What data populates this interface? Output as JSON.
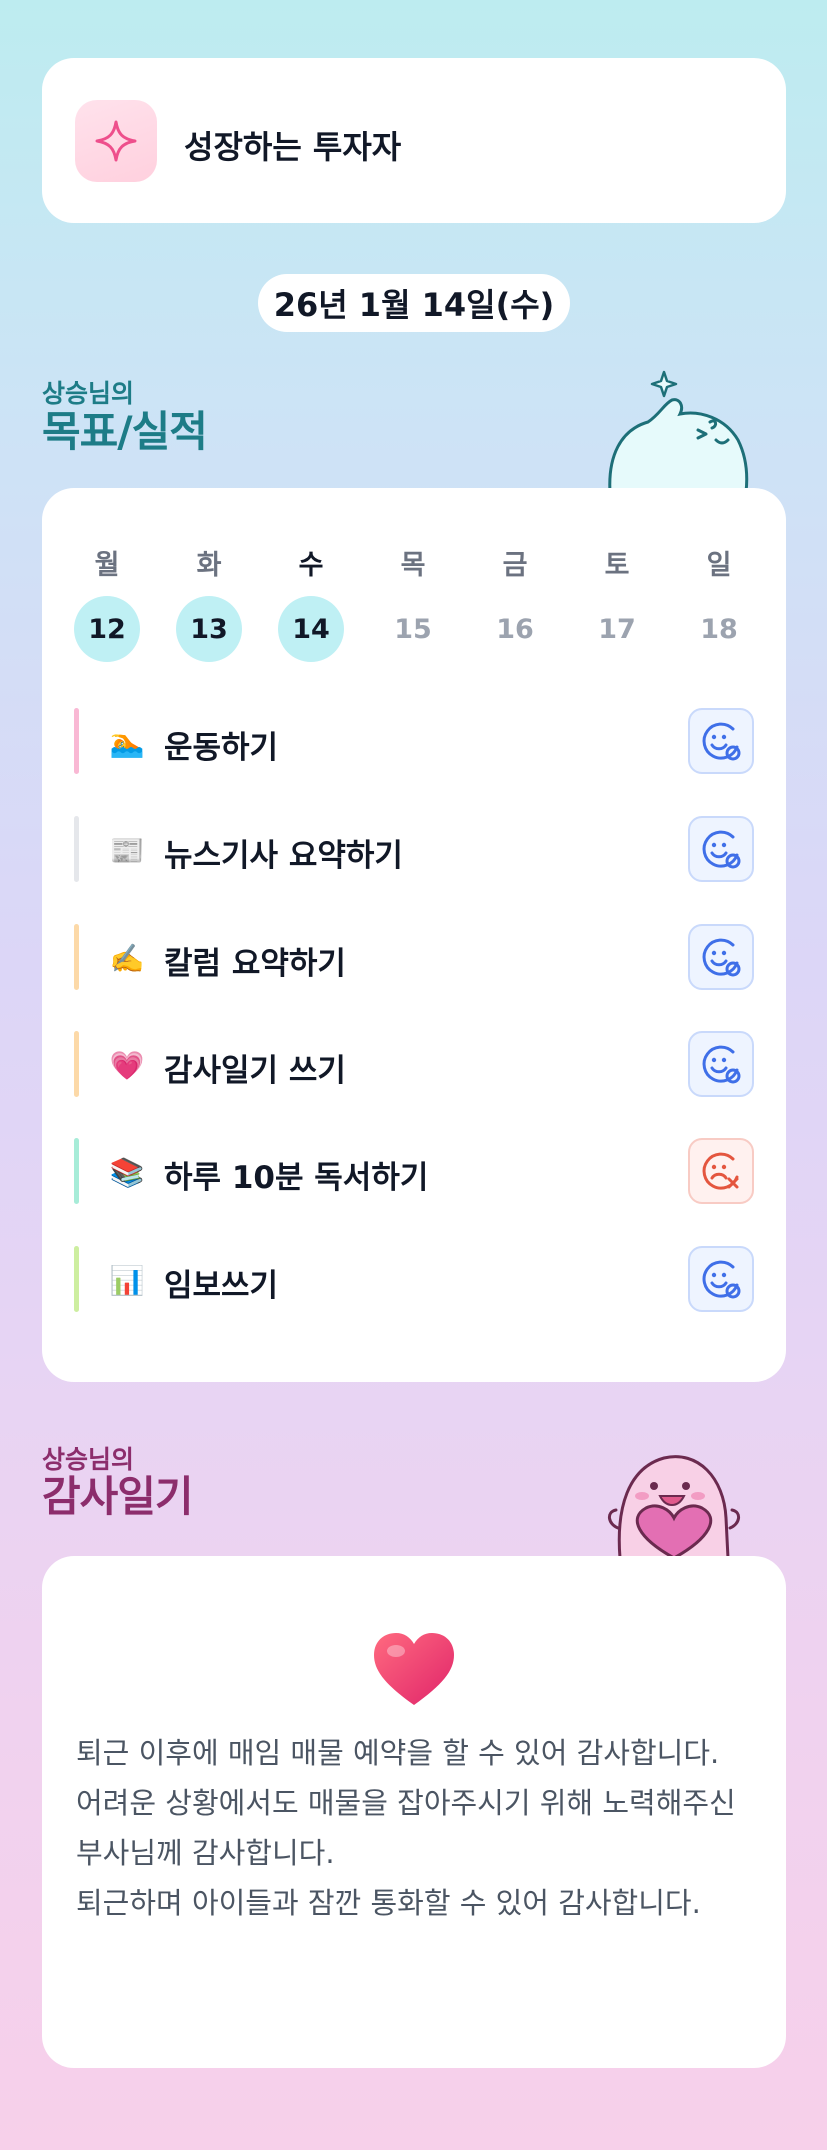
{
  "profile": {
    "name": "성장하는 투자자",
    "icon": "sparkle-icon"
  },
  "date": "26년 1월 14일(수)",
  "goals_section": {
    "owner": "상승님의",
    "title": "목표/실적"
  },
  "week": [
    {
      "day": "월",
      "num": "12",
      "done": true,
      "today": false
    },
    {
      "day": "화",
      "num": "13",
      "done": true,
      "today": false
    },
    {
      "day": "수",
      "num": "14",
      "done": true,
      "today": true
    },
    {
      "day": "목",
      "num": "15",
      "done": false,
      "today": false
    },
    {
      "day": "금",
      "num": "16",
      "done": false,
      "today": false
    },
    {
      "day": "토",
      "num": "17",
      "done": false,
      "today": false
    },
    {
      "day": "일",
      "num": "18",
      "done": false,
      "today": false
    }
  ],
  "goals": [
    {
      "emoji": "🏊",
      "label": "운동하기",
      "bar_color": "#f9b8d4",
      "status": "completed",
      "status_icon": "smile-check-icon"
    },
    {
      "emoji": "📰",
      "label": "뉴스기사 요약하기",
      "bar_color": "#e5e7eb",
      "status": "completed",
      "status_icon": "smile-check-icon"
    },
    {
      "emoji": "✍️",
      "label": "칼럼 요약하기",
      "bar_color": "#fcd9a8",
      "status": "completed",
      "status_icon": "smile-check-icon"
    },
    {
      "emoji": "💗",
      "label": "감사일기 쓰기",
      "bar_color": "#fcd9a8",
      "status": "completed",
      "status_icon": "smile-check-icon"
    },
    {
      "emoji": "📚",
      "label": "하루 10분 독서하기",
      "bar_color": "#a7ecd8",
      "status": "failed",
      "status_icon": "sad-x-icon"
    },
    {
      "emoji": "📊",
      "label": "임보쓰기",
      "bar_color": "#cdeea0",
      "status": "completed",
      "status_icon": "smile-check-icon"
    }
  ],
  "diary_section": {
    "owner": "상승님의",
    "title": "감사일기"
  },
  "diary": {
    "icon": "heart-icon",
    "text": "퇴근 이후에 매임 매물 예약을 할 수 있어 감사합니다.\n어려운 상황에서도 매물을 잡아주시기 위해 노력해주신 부사님께 감사합니다.\n퇴근하며 아이들과 잠깐 통화할 수 있어 감사합니다."
  },
  "colors": {
    "accent_teal": "#1d7c87",
    "accent_plum": "#8c2d6c",
    "done_circle": "#bff0f4",
    "ok_blue": "#3f6fe8",
    "fail_red": "#e4563f"
  }
}
